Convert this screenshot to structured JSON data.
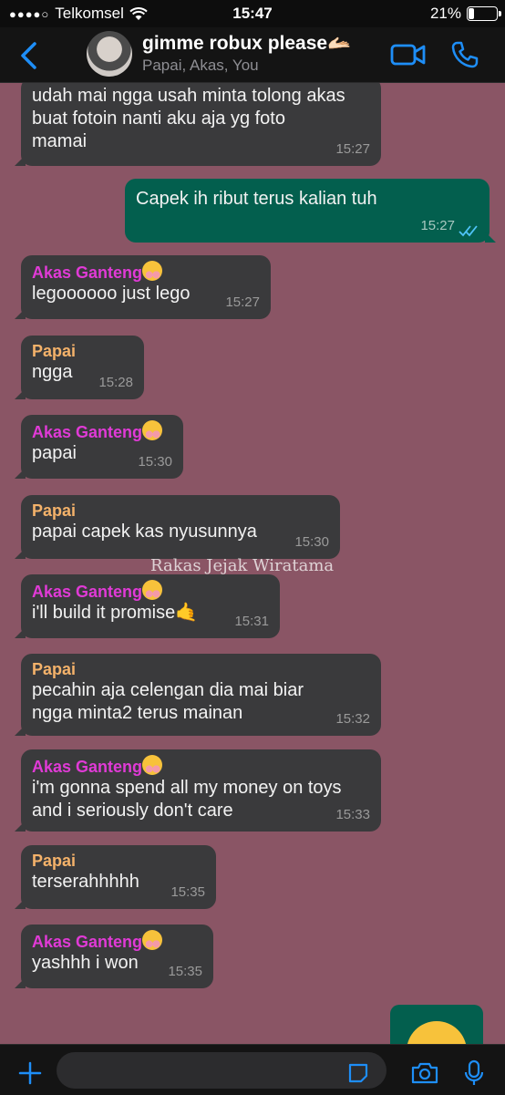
{
  "status_bar": {
    "signal_dots": "●●●●○",
    "carrier": "Telkomsel",
    "time": "15:47",
    "battery_percent": "21%",
    "battery_level": 0.21
  },
  "header": {
    "group_name": "gimme robux please",
    "group_emoji": "🫴🏻",
    "members": "Papai, Akas, You"
  },
  "colors": {
    "background": "#8a5565",
    "incoming_bubble": "#3a3a3c",
    "outgoing_bubble": "#035f4e",
    "akas_name": "#e03ad6",
    "papai_name": "#f4b26a",
    "accent_blue": "#1e8ef7"
  },
  "messages": [
    {
      "direction": "in",
      "sender": "",
      "lines": [
        "udah mai ngga usah minta tolong akas",
        "buat fotoin nanti aku aja yg foto",
        "mamai"
      ],
      "time": "15:27"
    },
    {
      "direction": "out",
      "sender": "",
      "lines": [
        "Capek ih ribut terus kalian tuh"
      ],
      "time": "15:27"
    },
    {
      "direction": "in",
      "sender": "Akas Ganteng",
      "lines": [
        "legoooooo just lego"
      ],
      "time": "15:27"
    },
    {
      "direction": "in",
      "sender": "Papai",
      "lines": [
        "ngga"
      ],
      "time": "15:28"
    },
    {
      "direction": "in",
      "sender": "Akas Ganteng",
      "lines": [
        "papai"
      ],
      "time": "15:30"
    },
    {
      "direction": "in",
      "sender": "Papai",
      "lines": [
        "papai capek kas nyusunnya"
      ],
      "time": "15:30"
    },
    {
      "direction": "in",
      "sender": "Akas Ganteng",
      "lines": [
        "i'll build it promise"
      ],
      "time": "15:31"
    },
    {
      "direction": "in",
      "sender": "Papai",
      "lines": [
        "pecahin aja celengan dia mai biar",
        "ngga minta2 terus mainan"
      ],
      "time": "15:32"
    },
    {
      "direction": "in",
      "sender": "Akas Ganteng",
      "lines": [
        "i'm gonna spend all my money on toys",
        "and i seriously don't care"
      ],
      "time": "15:33"
    },
    {
      "direction": "in",
      "sender": "Papai",
      "lines": [
        "terserahhhhh"
      ],
      "time": "15:35"
    },
    {
      "direction": "in",
      "sender": "Akas Ganteng",
      "lines": [
        "yashhh i won"
      ],
      "time": "15:35"
    }
  ],
  "watermark": "Rakas Jejak Wiratama",
  "input": {
    "placeholder": ""
  }
}
